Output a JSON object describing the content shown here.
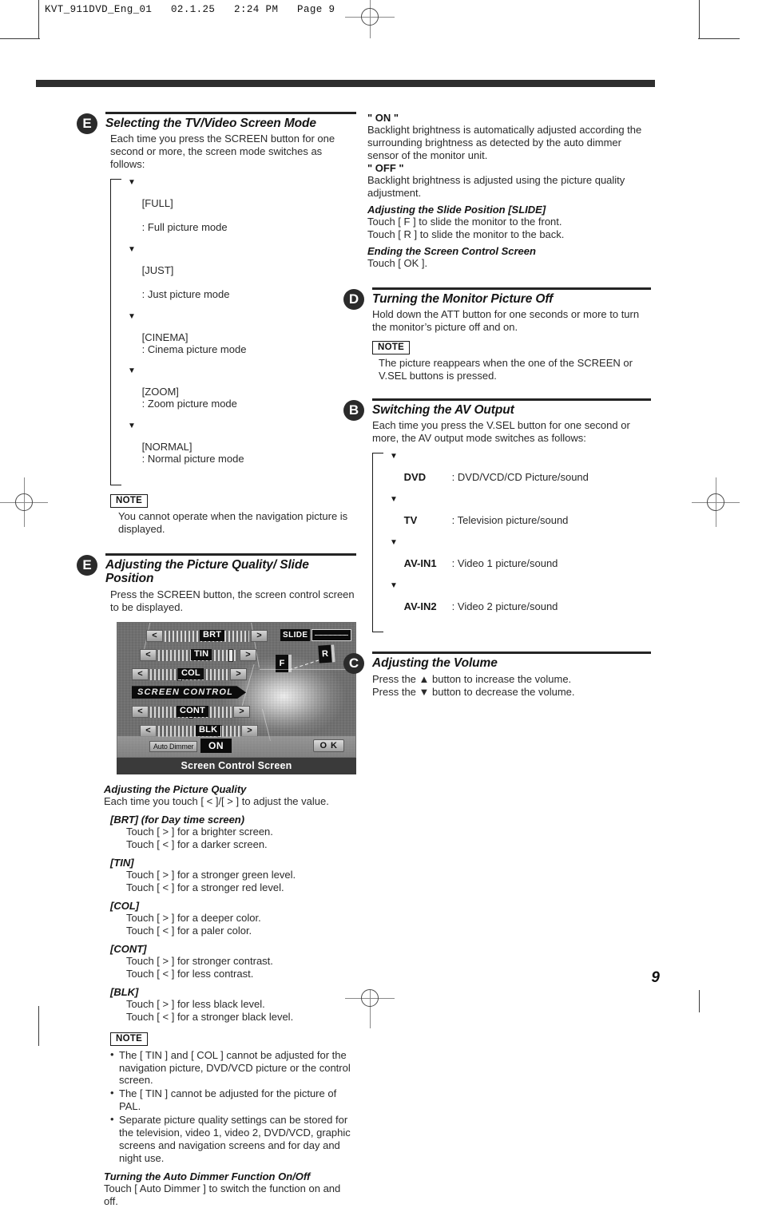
{
  "page": {
    "slug": "KVT_911DVD_Eng_01   02.1.25   2:24 PM   Page 9",
    "number": "9"
  },
  "left_column": {
    "section_e1": {
      "badge": "E",
      "title": "Selecting the TV/Video Screen Mode",
      "intro": "Each time you press the SCREEN button for one second or more, the screen mode switches as follows:",
      "flow": [
        {
          "label": "[FULL]",
          "desc": ": Full picture mode"
        },
        {
          "label": "[JUST]",
          "desc": ": Just picture mode"
        },
        {
          "label": "[CINEMA]",
          "desc": ": Cinema picture mode"
        },
        {
          "label": "[ZOOM]",
          "desc": ": Zoom picture mode"
        },
        {
          "label": "[NORMAL]",
          "desc": ": Normal picture mode"
        }
      ],
      "note_label": "NOTE",
      "note_text": "You cannot operate when the navigation picture is displayed."
    },
    "section_e2": {
      "badge": "E",
      "title": "Adjusting the Picture Quality/ Slide Position",
      "intro": "Press the SCREEN button, the screen control screen to be displayed.",
      "figure": {
        "caption": "Screen Control Screen",
        "sliders": [
          "BRT",
          "TIN",
          "COL",
          "CONT",
          "BLK"
        ],
        "banner": "SCREEN CONTROL",
        "slide_label": "SLIDE",
        "front_key": "F",
        "rear_key": "R",
        "dimmer_key": "Auto Dimmer",
        "dimmer_state": "ON",
        "ok_key": "O K",
        "left_arrow": "<",
        "right_arrow": ">"
      },
      "quality": {
        "heading": "Adjusting the Picture Quality",
        "intro": "Each time you touch [ < ]/[ > ] to adjust the value.",
        "items": [
          {
            "name": "[BRT] (for Day time screen)",
            "lines": [
              "Touch [ > ] for a brighter screen.",
              "Touch [ < ] for a darker screen."
            ]
          },
          {
            "name": "[TIN]",
            "lines": [
              "Touch [ > ] for a stronger green level.",
              "Touch [ < ] for a stronger red level."
            ]
          },
          {
            "name": "[COL]",
            "lines": [
              "Touch [ > ] for a deeper color.",
              "Touch [ < ] for a paler color."
            ]
          },
          {
            "name": "[CONT]",
            "lines": [
              "Touch [ > ] for stronger contrast.",
              "Touch [ < ] for less contrast."
            ]
          },
          {
            "name": "[BLK]",
            "lines": [
              "Touch [ > ] for less black level.",
              "Touch [ < ] for a stronger black level."
            ]
          }
        ],
        "note_label": "NOTE",
        "note_bullets": [
          "The [ TIN ] and [ COL ] cannot be adjusted for the navigation picture, DVD/VCD picture or the control screen.",
          "The [ TIN ] cannot be adjusted for the picture of PAL.",
          "Separate picture quality settings can be stored for the television, video 1, video 2, DVD/VCD, graphic screens and navigation screens and for day and night use."
        ]
      },
      "dimmer": {
        "heading": "Turning the Auto Dimmer Function On/Off",
        "text": "Touch [ Auto Dimmer ] to switch the function on and off."
      }
    }
  },
  "right_column": {
    "dimmer_states": {
      "on_label": "\" ON \"",
      "on_text": "Backlight brightness is automatically adjusted according the surrounding brightness as detected by the auto dimmer sensor of the monitor unit.",
      "off_label": "\" OFF \"",
      "off_text": "Backlight brightness is adjusted using the picture quality adjustment."
    },
    "slide_position": {
      "heading": "Adjusting the Slide Position [SLIDE]",
      "lines": [
        "Touch [ F ] to slide the monitor to the front.",
        "Touch [ R ] to slide the monitor to the back."
      ]
    },
    "ending": {
      "heading": "Ending the Screen Control Screen",
      "text": "Touch [ OK ]."
    },
    "section_d": {
      "badge": "D",
      "title": "Turning the Monitor Picture Off",
      "intro": "Hold down the ATT button for one seconds or more to turn the monitor’s picture off and on.",
      "note_label": "NOTE",
      "note_text": "The picture reappears when the one of the SCREEN or V.SEL buttons is pressed."
    },
    "section_b": {
      "badge": "B",
      "title": "Switching the AV Output",
      "intro": "Each time you press the V.SEL button for one second or more, the AV output mode switches as follows:",
      "flow": [
        {
          "label": "DVD",
          "desc": ": DVD/VCD/CD Picture/sound"
        },
        {
          "label": "TV",
          "desc": ": Television picture/sound"
        },
        {
          "label": "AV-IN1",
          "desc": ": Video 1 picture/sound"
        },
        {
          "label": "AV-IN2",
          "desc": ": Video 2 picture/sound"
        }
      ]
    },
    "section_c": {
      "badge": "C",
      "title": "Adjusting the Volume",
      "lines": [
        "Press the ▲ button to increase the volume.",
        "Press the ▼ button to decrease the volume."
      ]
    }
  }
}
